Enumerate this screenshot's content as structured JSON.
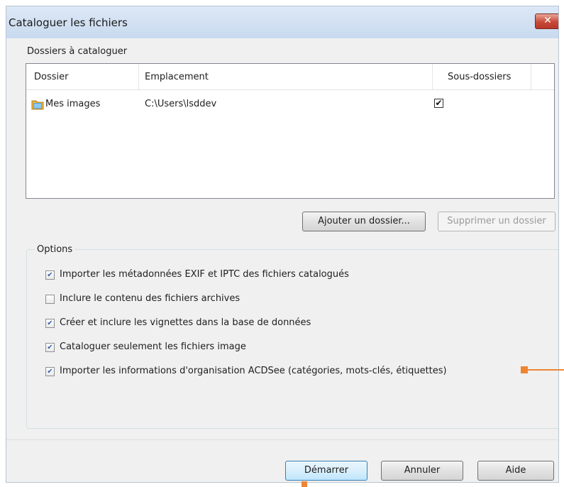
{
  "window": {
    "title": "Cataloguer les fichiers",
    "close_glyph": "✕"
  },
  "folders_section": {
    "label": "Dossiers à cataloguer",
    "columns": [
      "Dossier",
      "Emplacement",
      "Sous-dossiers"
    ],
    "rows": [
      {
        "dossier": "Mes images",
        "emplacement": "C:\\Users\\lsddev",
        "sous_dossiers_checked": true,
        "icon": "folder-icon"
      }
    ]
  },
  "buttons": {
    "add_folder": "Ajouter un dossier...",
    "remove_folder": "Supprimer un dossier",
    "start": "Démarrer",
    "cancel": "Annuler",
    "help": "Aide"
  },
  "options": {
    "label": "Options",
    "items": [
      {
        "label": "Importer les métadonnées EXIF et IPTC des fichiers catalogués",
        "checked": true
      },
      {
        "label": "Inclure le contenu des fichiers archives",
        "checked": false
      },
      {
        "label": "Créer et inclure les vignettes dans la base de données",
        "checked": true
      },
      {
        "label": "Cataloguer seulement les fichiers image",
        "checked": true
      },
      {
        "label": "Importer les informations d'organisation ACDSee (catégories, mots-clés, étiquettes)",
        "checked": true
      }
    ]
  },
  "check_glyph": "✔",
  "colors": {
    "accent_marker": "#ee8533",
    "titlebar": "#c9daef",
    "close_button": "#c74a38"
  }
}
